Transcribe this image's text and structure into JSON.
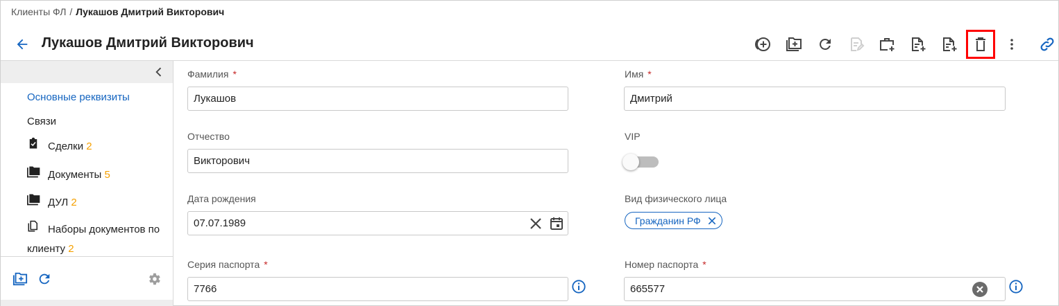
{
  "breadcrumb": {
    "parent": "Клиенты ФЛ",
    "separator": "/",
    "current": "Лукашов Дмитрий Викторович"
  },
  "header": {
    "title": "Лукашов Дмитрий Викторович"
  },
  "toolbar": {
    "icons": [
      "add-circle-icon",
      "folder-add-icon",
      "refresh-icon",
      "edit-note-icon",
      "briefcase-add-icon",
      "document-add-icon",
      "document-add-alt-icon",
      "delete-icon",
      "more-vert-icon",
      "link-icon"
    ],
    "highlighted": "delete-icon"
  },
  "sidebar": {
    "active_link": "Основные реквизиты",
    "links": [
      "Связи"
    ],
    "items": [
      {
        "label": "Сделки",
        "count": "2",
        "icon": "clipboard-check-icon"
      },
      {
        "label": "Документы",
        "count": "5",
        "icon": "folder-icon"
      },
      {
        "label": "ДУЛ",
        "count": "2",
        "icon": "folder-icon"
      },
      {
        "label": "Наборы документов по клиенту",
        "count": "2",
        "icon": "document-stack-icon"
      }
    ]
  },
  "form": {
    "last_name": {
      "label": "Фамилия",
      "required": "*",
      "value": "Лукашов"
    },
    "first_name": {
      "label": "Имя",
      "required": "*",
      "value": "Дмитрий"
    },
    "patronymic": {
      "label": "Отчество",
      "value": "Викторович"
    },
    "vip": {
      "label": "VIP",
      "enabled": false
    },
    "birth_date": {
      "label": "Дата рождения",
      "value": "07.07.1989"
    },
    "person_type": {
      "label": "Вид физического лица",
      "chip": "Гражданин РФ"
    },
    "passport_series": {
      "label": "Серия паспорта",
      "required": "*",
      "value": "7766"
    },
    "passport_number": {
      "label": "Номер паспорта",
      "required": "*",
      "value": "665577"
    }
  },
  "colors": {
    "accent": "#1565c0",
    "count": "#f5a000",
    "required": "#c62828",
    "highlight": "#ff0000"
  }
}
